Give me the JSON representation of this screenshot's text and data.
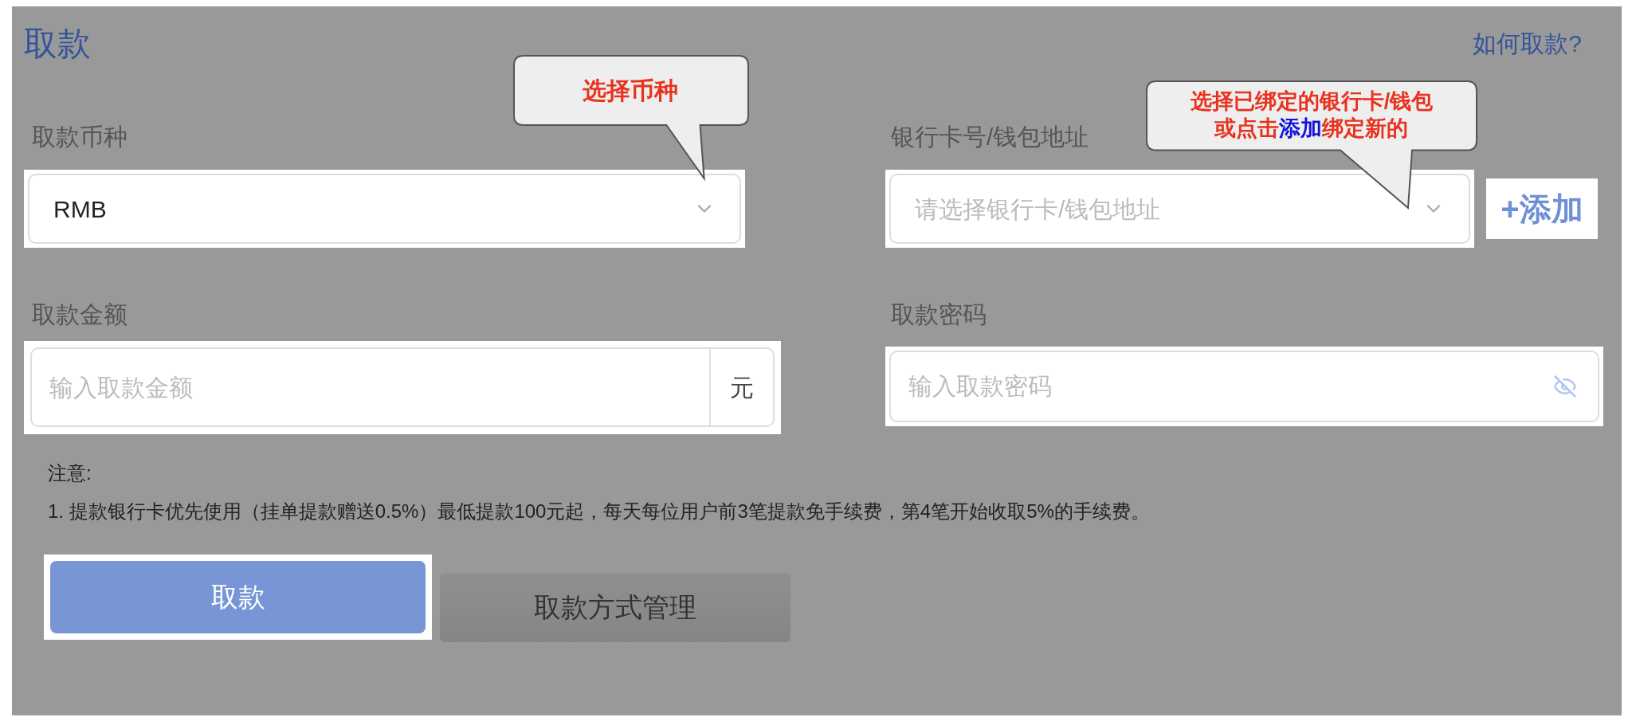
{
  "header": {
    "title": "取款",
    "help_link": "如何取款?"
  },
  "currency": {
    "label": "取款币种",
    "value": "RMB"
  },
  "account": {
    "label": "银行卡号/钱包地址",
    "placeholder": "请选择银行卡/钱包地址",
    "add_button": "+添加"
  },
  "amount": {
    "label": "取款金额",
    "placeholder": "输入取款金额",
    "unit": "元"
  },
  "password": {
    "label": "取款密码",
    "placeholder": "输入取款密码"
  },
  "notice": {
    "title": "注意:",
    "lines": [
      "1. 提款银行卡优先使用（挂单提款赠送0.5%）最低提款100元起，每天每位用户前3笔提款免手续费，第4笔开始收取5%的手续费。"
    ]
  },
  "buttons": [
    {
      "label": "取款",
      "kind": "primary"
    },
    {
      "label": "取款方式管理",
      "kind": "secondary"
    }
  ],
  "callouts": [
    {
      "lines": [
        [
          {
            "text": "选择币种",
            "highlight": false
          }
        ]
      ]
    },
    {
      "lines": [
        [
          {
            "text": "选择已绑定的银行卡/钱包",
            "highlight": false
          }
        ],
        [
          {
            "text": "或点击",
            "highlight": false
          },
          {
            "text": "添加",
            "highlight": true
          },
          {
            "text": "绑定新的",
            "highlight": false
          }
        ]
      ]
    }
  ]
}
